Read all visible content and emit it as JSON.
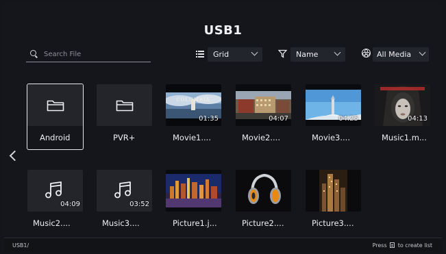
{
  "title": "USB1",
  "search": {
    "placeholder": "Search File"
  },
  "view_dropdown": {
    "value": "Grid",
    "icon": "list-icon"
  },
  "sort_dropdown": {
    "value": "Name",
    "icon": "filter-icon"
  },
  "media_dropdown": {
    "value": "All Media",
    "icon": "media-icon"
  },
  "items": [
    {
      "label": "Android",
      "type": "folder"
    },
    {
      "label": "PVR+",
      "type": "folder"
    },
    {
      "label": "Movie1....",
      "type": "video",
      "duration": "01:35"
    },
    {
      "label": "Movie2....",
      "type": "video",
      "duration": "04:07"
    },
    {
      "label": "Movie3....",
      "type": "video",
      "duration": "04:25"
    },
    {
      "label": "Music1.m...",
      "type": "music",
      "duration": "04:13"
    },
    {
      "label": "Music2....",
      "type": "music",
      "duration": "04:09"
    },
    {
      "label": "Music3....",
      "type": "music",
      "duration": "03:52"
    },
    {
      "label": "Picture1.j...",
      "type": "picture"
    },
    {
      "label": "Picture2....",
      "type": "picture"
    },
    {
      "label": "Picture3....",
      "type": "picture"
    }
  ],
  "status": {
    "path": "USB1/",
    "hint_prefix": "Press",
    "hint_suffix": "to create list"
  },
  "colors": {
    "background": "#15161b",
    "tile": "#23252b",
    "accent": "#e9e9ef"
  }
}
